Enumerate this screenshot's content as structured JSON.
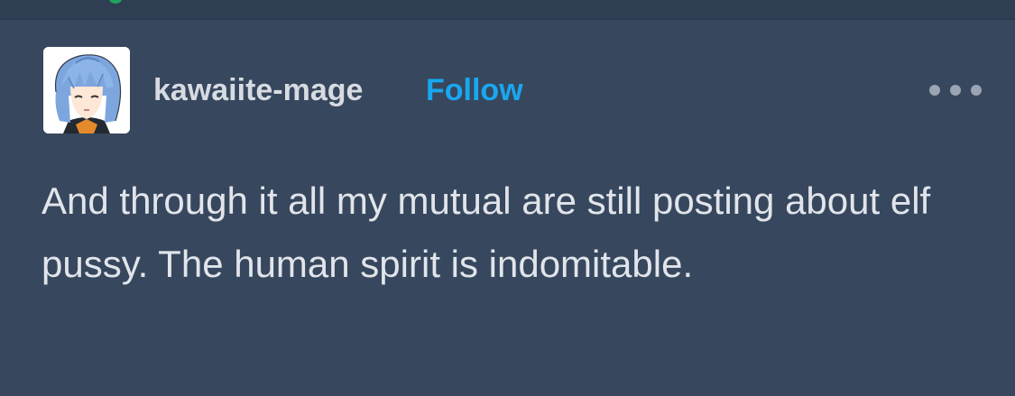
{
  "post": {
    "username": "kawaiite-mage",
    "follow_label": "Follow",
    "body": "And through it all my mutual are still posting about elf pussy. The human spirit is indomitable.",
    "avatar_icon": "anime-avatar-icon",
    "more_icon": "ellipsis-icon"
  },
  "colors": {
    "background": "#37475d",
    "username": "#d7dbe2",
    "follow": "#19a7f0",
    "text": "#e1e5eb"
  }
}
